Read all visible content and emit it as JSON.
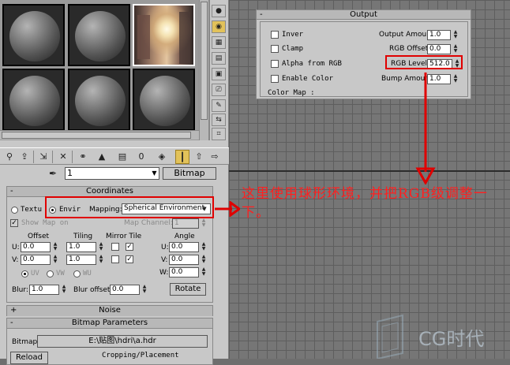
{
  "output_panel": {
    "title": "Output",
    "invert_label": "Inver",
    "clamp_label": "Clamp",
    "alpha_label": "Alpha from RGB",
    "enable_color_label": "Enable Color",
    "output_amount_label": "Output Amount:",
    "output_amount_value": "1.0",
    "rgb_offset_label": "RGB Offset:",
    "rgb_offset_value": "0.0",
    "rgb_level_label": "RGB Level:",
    "rgb_level_value": "512.0",
    "bump_amount_label": "Bump Amoun",
    "bump_amount_value": "1.0",
    "color_map_label": "Color Map :"
  },
  "material_editor": {
    "material_name": "1",
    "type_button": "Bitmap",
    "toolbar_icons": [
      "get-material-icon",
      "put-to-scene-icon",
      "assign-to-selection-icon",
      "reset-map-icon",
      "copy-material-icon",
      "make-unique-icon",
      "put-to-library-icon",
      "material-id-icon",
      "show-map-in-viewport-icon",
      "show-end-result-icon",
      "go-to-parent-icon",
      "go-forward-to-sibling-icon"
    ],
    "sidebar_icons": [
      "sample-type-icon",
      "backlight-icon",
      "background-icon",
      "sample-uv-tiling-icon",
      "video-color-check-icon",
      "make-preview-icon",
      "options-icon",
      "select-by-material-icon",
      "material-map-navigator-icon"
    ]
  },
  "coordinates": {
    "title": "Coordinates",
    "texture_label": "Textu",
    "environ_label": "Envir",
    "mapping_label": "Mapping:",
    "mapping_value": "Spherical Environment",
    "show_map_on_label": "Show Map on",
    "map_channel_label": "Map Channel:",
    "map_channel_value": "1",
    "offset_label": "Offset",
    "tiling_label": "Tiling",
    "mirror_tile_label": "Mirror Tile",
    "angle_label": "Angle",
    "u_label": "U:",
    "v_label": "V:",
    "w_label": "W:",
    "u_offset": "0.0",
    "v_offset": "0.0",
    "u_tiling": "1.0",
    "v_tiling": "1.0",
    "u_angle": "0.0",
    "v_angle": "0.0",
    "w_angle": "0.0",
    "uv_label": "UV",
    "vw_label": "VW",
    "wu_label": "WU",
    "blur_label": "Blur:",
    "blur_value": "1.0",
    "blur_offset_label": "Blur offset:",
    "blur_offset_value": "0.0",
    "rotate_button": "Rotate"
  },
  "noise_rollout": {
    "title": "Noise"
  },
  "bitmap_params": {
    "title": "Bitmap Parameters",
    "bitmap_label": "Bitmap:",
    "bitmap_path": "E:\\贴图\\hdri\\a.hdr",
    "reload_button": "Reload",
    "cropping_label": "Cropping/Placement"
  },
  "annotation": {
    "note": "这里使用球形环境，并把RGB级调整一下。"
  },
  "watermark": {
    "text": "CG时代"
  },
  "colors": {
    "annotation_red": "#e00000",
    "active_tool": "#e2c25a"
  }
}
